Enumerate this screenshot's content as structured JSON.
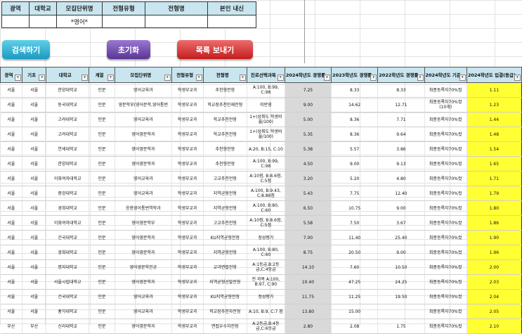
{
  "filter": {
    "headers": [
      "광역",
      "대학교",
      "모집단위명",
      "전형유형",
      "전형명",
      "본인 내신"
    ],
    "values": [
      "",
      "",
      "*영어*",
      "",
      "",
      ""
    ]
  },
  "buttons": {
    "search": "검색하기",
    "reset": "초기화",
    "send": "목록 보내기"
  },
  "table": {
    "columns": [
      "광역",
      "기초",
      "대학교",
      "계열",
      "모집단위명",
      "전형유형",
      "전형명",
      "진로선택과목",
      "2024학년도 경쟁률",
      "2023학년도 경쟁률",
      "2022학년도 경쟁률",
      "2024학년도 기준",
      "2024학년도 입결(등급)"
    ],
    "rows": [
      [
        "서울",
        "서울",
        "한양대학교",
        "인문",
        "영어교육과",
        "학생부교과",
        "추천형전형",
        "A:100, B:99, C:98",
        "7.25",
        "8.33",
        "8.33",
        "최종등록자70%컷",
        "1.11"
      ],
      [
        "서울",
        "서울",
        "동국대학교",
        "인문",
        "영문학부(영어문학,영어통번",
        "학생부교과",
        "학교장추천인재전형",
        "미반영",
        "9.00",
        "14.62",
        "12.71",
        "최종등록자70%컷 (10개)",
        "1.23"
      ],
      [
        "서울",
        "서울",
        "고려대학교",
        "인문",
        "영어교육과",
        "학생부교과",
        "학교추천전형",
        "1+(성취도 학생비율/100)",
        "5.00",
        "8.36",
        "7.71",
        "최종등록자70%컷",
        "1.44"
      ],
      [
        "서울",
        "서울",
        "고려대학교",
        "인문",
        "영어영문학과",
        "학생부교과",
        "학교추천전형",
        "1+(성취도 학생비율/100)",
        "5.35",
        "8.36",
        "9.64",
        "최종등록자70%컷",
        "1.48"
      ],
      [
        "서울",
        "서울",
        "연세대학교",
        "인문",
        "영어영문학과",
        "학생부교과",
        "추천형전형",
        "A:20, B:15, C:10",
        "5.38",
        "5.57",
        "3.86",
        "최종등록자70%컷",
        "1.54"
      ],
      [
        "서울",
        "서울",
        "한양대학교",
        "인문",
        "영어영문학과",
        "학생부교과",
        "추천형전형",
        "A:100, B:99, C:98",
        "4.50",
        "9.00",
        "9.13",
        "최종등록자70%컷",
        "1.65"
      ],
      [
        "서울",
        "서울",
        "이화여자대학교",
        "인문",
        "영어교육과",
        "학생부교과",
        "고교추천전형",
        "A:10점, B:8.6점, C:5점",
        "3.20",
        "5.20",
        "4.80",
        "최종등록자70%컷",
        "1.71"
      ],
      [
        "서울",
        "서울",
        "중앙대학교",
        "인문",
        "영어교육과",
        "학생부교과",
        "지역균형전형",
        "A:100, B:9.43, C:8.86점",
        "5.43",
        "7.75",
        "12.40",
        "최종등록자70%컷",
        "1.79"
      ],
      [
        "서울",
        "서울",
        "경희대학교",
        "인문",
        "응용영어통번역학과",
        "학생부교과",
        "지역균형전형",
        "A:100, B:80, C:60",
        "6.50",
        "10.75",
        "9.00",
        "최종등록자70%컷",
        "1.80"
      ],
      [
        "서울",
        "서울",
        "이화여자대학교",
        "인문",
        "영어영문학부",
        "학생부교과",
        "고교추천전형",
        "A:10점, B:8.6점, C:5점",
        "5.58",
        "7.50",
        "3.67",
        "최종등록자70%컷",
        "1.86"
      ],
      [
        "서울",
        "서울",
        "건국대학교",
        "인문",
        "영어영문학과",
        "학생부교과",
        "KU지역균형전형",
        "정성평가",
        "7.00",
        "11.40",
        "25.40",
        "최종등록자70%컷",
        "1.90"
      ],
      [
        "서울",
        "서울",
        "경희대학교",
        "인문",
        "영어영문학과",
        "학생부교과",
        "지역균형전형",
        "A:100, B:80, C:60",
        "8.75",
        "20.50",
        "9.00",
        "최종등록자70%컷",
        "1.96"
      ],
      [
        "서울",
        "서울",
        "명지대학교",
        "인문",
        "영어영문학전공",
        "학생부교과",
        "교과면접전형",
        "A:1등급,B:2등급,C:4등급",
        "14.10",
        "7.60",
        "10.50",
        "최종등록자70%컷",
        "2.00"
      ],
      [
        "서울",
        "서울",
        "서울시립대학교",
        "인문",
        "영어영문학과",
        "학생부교과",
        "지역균형선발전형",
        "전 과목 A:100, B:97, C:90",
        "10.40",
        "47.25",
        "24.25",
        "최종등록자70%컷",
        "2.03"
      ],
      [
        "서울",
        "서울",
        "건국대학교",
        "인문",
        "영어교육과",
        "학생부교과",
        "KU지역균형전형",
        "정성평가",
        "11.75",
        "11.25",
        "19.50",
        "최종등록자70%컷",
        "2.04"
      ],
      [
        "서울",
        "서울",
        "홍익대학교",
        "인문",
        "영어교육과",
        "학생부교과",
        "학교장추천자전형",
        "A:10, B:9, C:7 점",
        "13.80",
        "15.00",
        "",
        "최종등록자70%컷",
        "2.05"
      ],
      [
        "부산",
        "부산",
        "신라대학교",
        "인문",
        "영어영문학과",
        "학생부교과",
        "면접우수자전형",
        "A:2등급,B:4등급,C:6등급",
        "2.80",
        "2.08",
        "1.75",
        "최종등록자70%컷",
        "2.10"
      ]
    ]
  }
}
